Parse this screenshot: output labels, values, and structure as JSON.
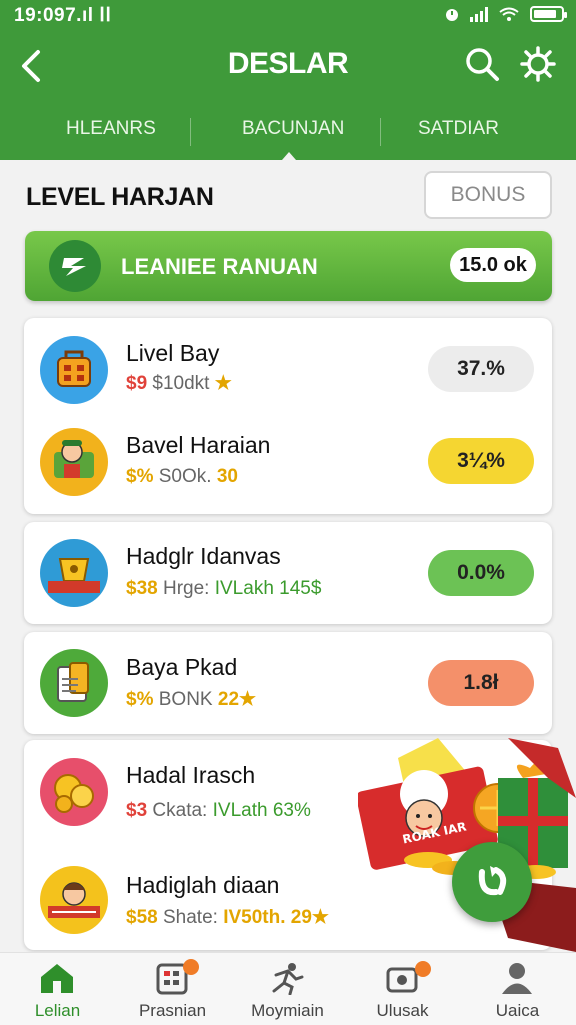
{
  "status_bar": {
    "time": "19:097.ıl ⅠⅠ"
  },
  "header": {
    "title": "DESLAR",
    "tabs": [
      {
        "label": "HLEANRS"
      },
      {
        "label": "BACUNJAN"
      },
      {
        "label": "SATDIAR"
      }
    ]
  },
  "section": {
    "title": "LEVEL HARJAN",
    "bonus_button": "BONUS"
  },
  "banner": {
    "label": "LEANIEE RANUAN",
    "value": "15.0 ok"
  },
  "rows": [
    {
      "title": "Livel Bay",
      "sub_a": "$9",
      "sub_b": " $10dkt ",
      "sub_c": "★",
      "value": "37.%"
    },
    {
      "title": "Bavel Haraian",
      "sub_a": "$%",
      "sub_b": " S0Ok. ",
      "sub_c": "30",
      "value": "3¼%"
    },
    {
      "title": "Hadglr Idanvas",
      "sub_a": "$38",
      "sub_b": " Hrge: ",
      "sub_c": "IVLakh 145$",
      "value": "0.0%"
    },
    {
      "title": "Baya Pkad",
      "sub_a": "$%",
      "sub_b": " BONK ",
      "sub_c": "22★",
      "value": "1.8ł"
    },
    {
      "title": "Hadal Irasch",
      "sub_a": "$3",
      "sub_b": " Ckata: ",
      "sub_c": "IVLath 63%",
      "value": ""
    },
    {
      "title": "Hadiglah diaan",
      "sub_a": "$58",
      "sub_b": " Shate: ",
      "sub_c": "IV50th. 29★",
      "value": ""
    }
  ],
  "promo": {
    "label": "ROAK IAR"
  },
  "bottom_nav": [
    {
      "label": "Lelian"
    },
    {
      "label": "Prasnian"
    },
    {
      "label": "Moymiain"
    },
    {
      "label": "Ulusak"
    },
    {
      "label": "Uaica"
    }
  ],
  "colors": {
    "brand_green": "#3f9a3a",
    "pill_gray": "#ececec",
    "pill_yellow": "#f5d631",
    "pill_green": "#6cc255",
    "pill_orange": "#f4906a",
    "accent_orange": "#f07c27"
  }
}
